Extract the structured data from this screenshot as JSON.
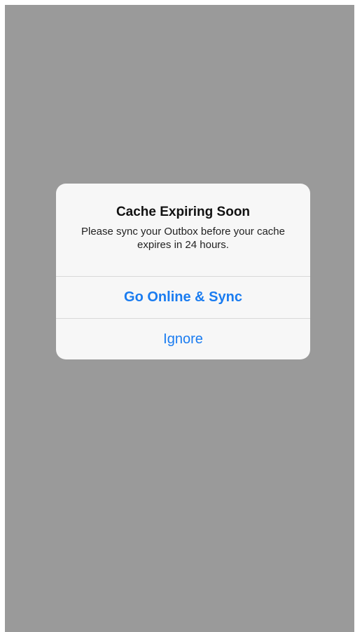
{
  "alert": {
    "title": "Cache Expiring Soon",
    "message": "Please sync your Outbox before your cache expires in 24 hours.",
    "buttons": [
      {
        "label": "Go Online & Sync",
        "style": "bold"
      },
      {
        "label": "Ignore",
        "style": "regular"
      }
    ]
  },
  "colors": {
    "backdrop": "#9a9a9a",
    "alert_background": "#f7f7f7",
    "button_text": "#1a7cf0",
    "separator": "#d9d9d9"
  }
}
